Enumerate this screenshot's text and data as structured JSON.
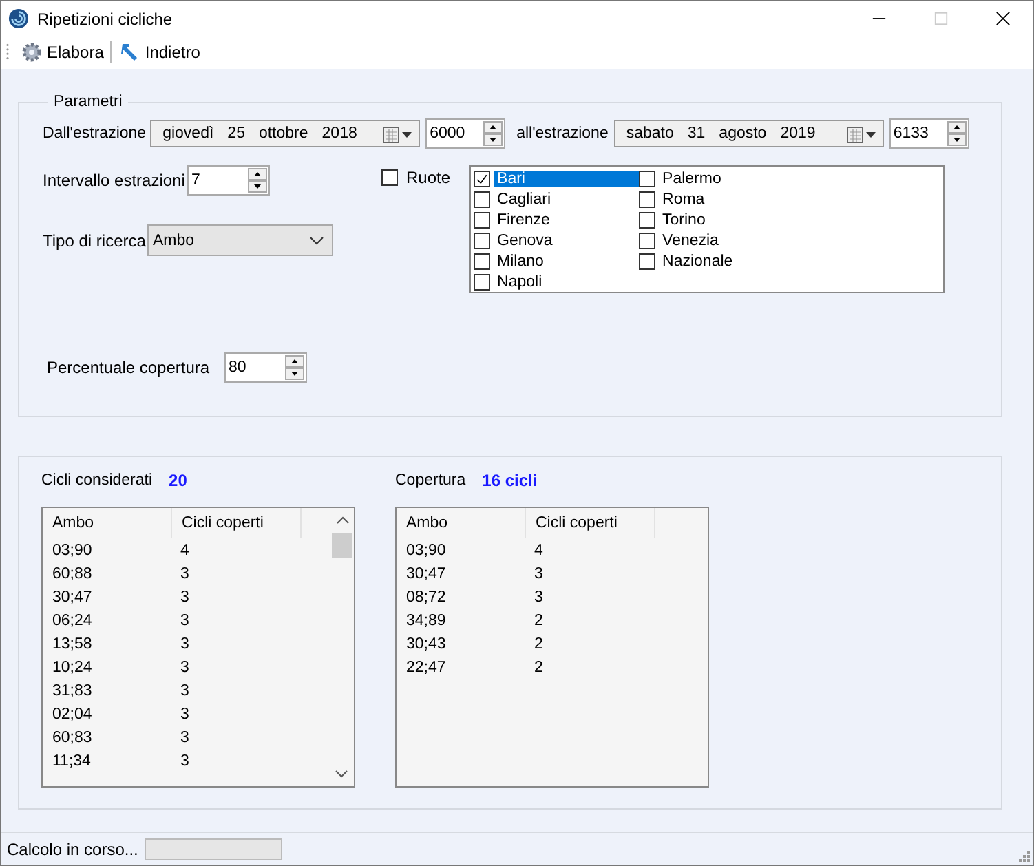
{
  "window": {
    "title": "Ripetizioni cicliche"
  },
  "toolbar": {
    "buttons": [
      {
        "kind": "gear",
        "label": "Elabora"
      },
      {
        "kind": "back",
        "label": "Indietro"
      }
    ]
  },
  "parametri": {
    "title": "Parametri",
    "from": {
      "label": "Dall'estrazione",
      "date": [
        "giovedì",
        "25",
        "ottobre",
        "2018"
      ],
      "number": "6000"
    },
    "to": {
      "label": "all'estrazione",
      "date": [
        "sabato",
        "31",
        "agosto",
        "2019"
      ],
      "number": "6133"
    },
    "intervallo": {
      "label": "Intervallo estrazioni",
      "value": "7"
    },
    "tipo": {
      "label": "Tipo di ricerca",
      "value": "Ambo"
    },
    "percentuale": {
      "label": "Percentuale copertura",
      "value": "80"
    },
    "ruote": {
      "label": "Ruote",
      "checked": false
    },
    "ruote_list": [
      {
        "label": "Bari",
        "checked": true,
        "selected": true
      },
      {
        "label": "Cagliari",
        "checked": false,
        "selected": false
      },
      {
        "label": "Firenze",
        "checked": false,
        "selected": false
      },
      {
        "label": "Genova",
        "checked": false,
        "selected": false
      },
      {
        "label": "Milano",
        "checked": false,
        "selected": false
      },
      {
        "label": "Napoli",
        "checked": false,
        "selected": false
      },
      {
        "label": "Palermo",
        "checked": false,
        "selected": false
      },
      {
        "label": "Roma",
        "checked": false,
        "selected": false
      },
      {
        "label": "Torino",
        "checked": false,
        "selected": false
      },
      {
        "label": "Venezia",
        "checked": false,
        "selected": false
      },
      {
        "label": "Nazionale",
        "checked": false,
        "selected": false
      }
    ]
  },
  "results": [
    {
      "label": "Cicli considerati",
      "value": "20",
      "scrollbar": true,
      "columns": [
        "Ambo",
        "Cicli coperti"
      ],
      "rows": [
        [
          "03;90",
          "4"
        ],
        [
          "60;88",
          "3"
        ],
        [
          "30;47",
          "3"
        ],
        [
          "06;24",
          "3"
        ],
        [
          "13;58",
          "3"
        ],
        [
          "10;24",
          "3"
        ],
        [
          "31;83",
          "3"
        ],
        [
          "02;04",
          "3"
        ],
        [
          "60;83",
          "3"
        ],
        [
          "11;34",
          "3"
        ]
      ]
    },
    {
      "label": "Copertura",
      "value": "16 cicli",
      "scrollbar": false,
      "columns": [
        "Ambo",
        "Cicli coperti"
      ],
      "rows": [
        [
          "03;90",
          "4"
        ],
        [
          "30;47",
          "3"
        ],
        [
          "08;72",
          "3"
        ],
        [
          "34;89",
          "2"
        ],
        [
          "30;43",
          "2"
        ],
        [
          "22;47",
          "2"
        ]
      ]
    }
  ],
  "status_bar": {
    "text": "Calcolo in corso...",
    "progress": {
      "level": 0
    }
  }
}
